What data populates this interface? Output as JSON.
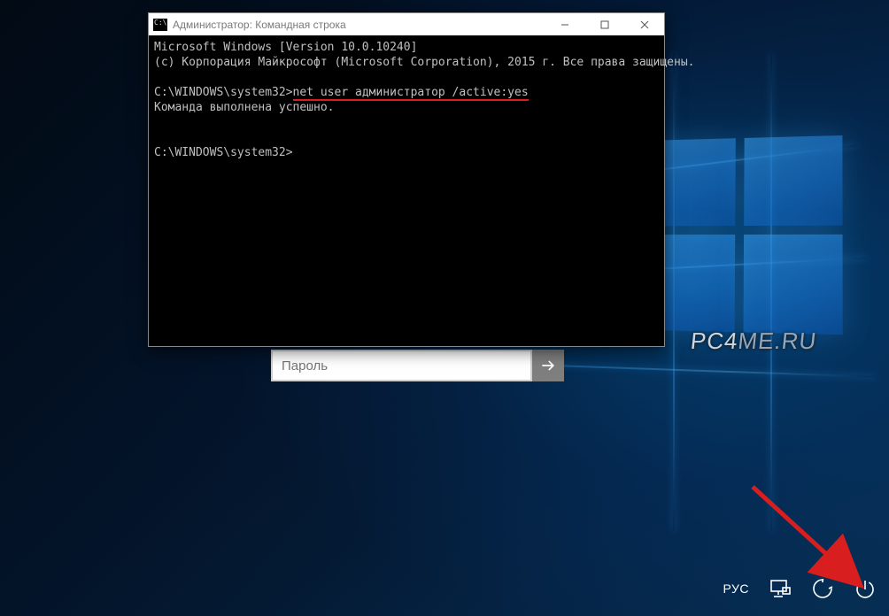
{
  "cmd_window": {
    "title": "Администратор: Командная строка",
    "line1": "Microsoft Windows [Version 10.0.10240]",
    "line2": "(c) Корпорация Майкрософт (Microsoft Corporation), 2015 г. Все права защищены.",
    "prompt1_prefix": "C:\\WINDOWS\\system32>",
    "command": "net user администратор /active:yes",
    "result": "Команда выполнена успешно.",
    "prompt2": "C:\\WINDOWS\\system32>"
  },
  "login": {
    "password_placeholder": "Пароль"
  },
  "lockbar": {
    "language": "РУС"
  },
  "watermark": {
    "text_a": "PC4",
    "text_b": "ME",
    "text_c": ".RU"
  }
}
